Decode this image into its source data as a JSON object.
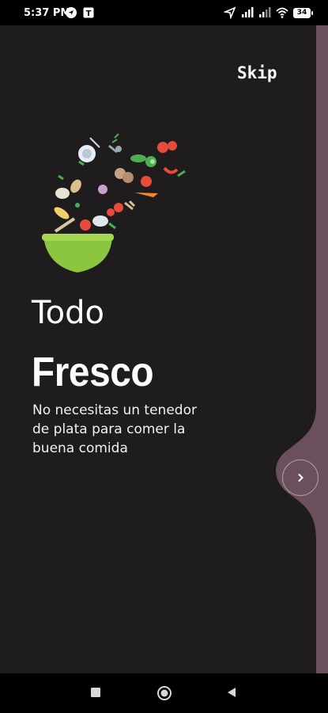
{
  "status_bar": {
    "time": "5:37 PM",
    "battery": "34",
    "left_icons": [
      "navigation-icon",
      "app-notification-icon"
    ],
    "right_icons": [
      "location-arrow-icon",
      "signal-icon",
      "signal-icon-2",
      "wifi-icon",
      "battery-icon"
    ]
  },
  "onboarding": {
    "skip_label": "Skip",
    "title_light": "Todo",
    "title_bold": "Fresco",
    "description": "No necesitas un tenedor de plata para comer la buena comida",
    "next_icon": "chevron-right-icon"
  },
  "colors": {
    "background": "#1e1c1d",
    "accent_panel": "#6b4f5d",
    "bowl": "#8cc63f"
  },
  "nav_bar": {
    "buttons": [
      "recent-apps-icon",
      "home-icon",
      "back-icon"
    ]
  }
}
